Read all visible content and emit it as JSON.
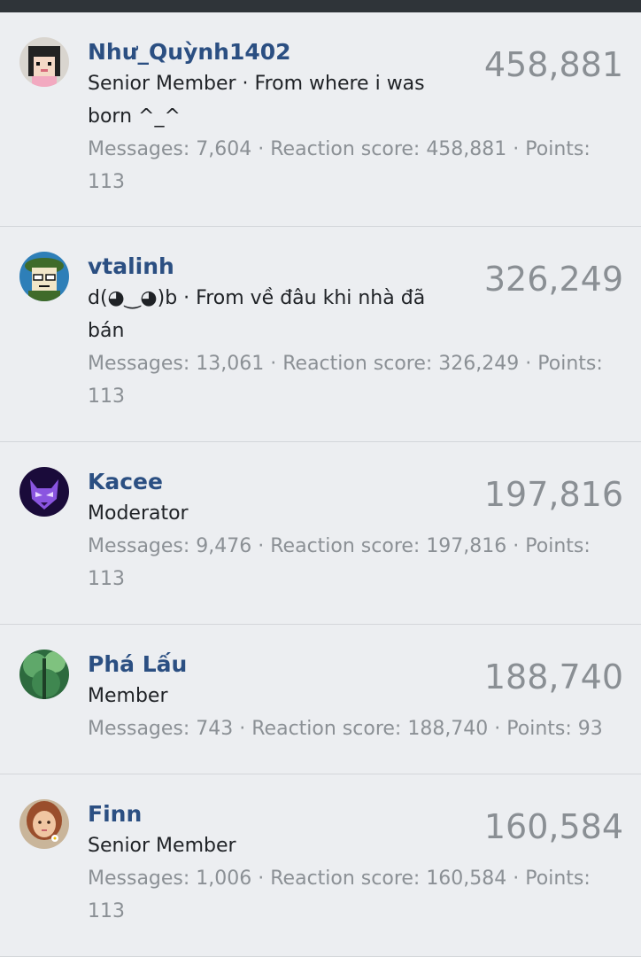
{
  "members": [
    {
      "name": "Như_Quỳnh1402",
      "title_line": "Senior Member · From where i was born ^_^",
      "stats": "Messages: 7,604 · Reaction score: 458,881 · Points: 113",
      "score": "458,881",
      "avatar_icon": "girl-avatar-icon"
    },
    {
      "name": "vtalinh",
      "title_line": "d(◕‿◕)b · From về đâu khi nhà đã bán",
      "stats": "Messages: 13,061 · Reaction score: 326,249 · Points: 113",
      "score": "326,249",
      "avatar_icon": "soldier-avatar-icon"
    },
    {
      "name": "Kacee",
      "title_line": "Moderator",
      "stats": "Messages: 9,476 · Reaction score: 197,816 · Points: 113",
      "score": "197,816",
      "avatar_icon": "wolf-avatar-icon"
    },
    {
      "name": "Phá Lấu",
      "title_line": "Member",
      "stats": "Messages: 743 · Reaction score: 188,740 · Points: 93",
      "score": "188,740",
      "avatar_icon": "forest-avatar-icon"
    },
    {
      "name": "Finn",
      "title_line": "Senior Member",
      "stats": "Messages: 1,006 · Reaction score: 160,584 · Points: 113",
      "score": "160,584",
      "avatar_icon": "portrait-avatar-icon"
    }
  ]
}
